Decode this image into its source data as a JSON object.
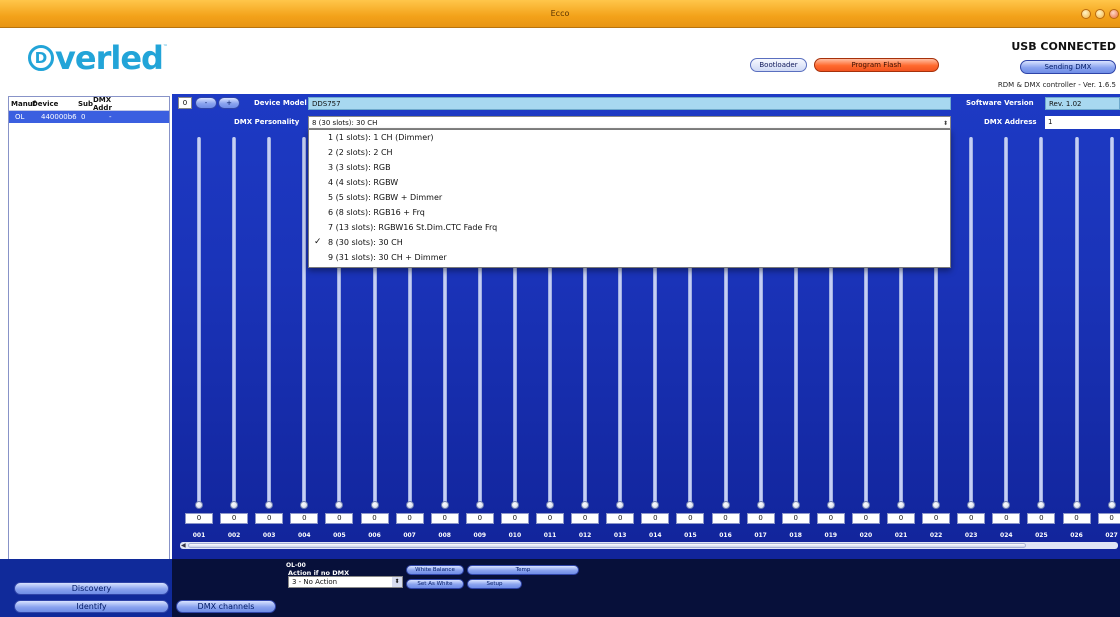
{
  "window": {
    "title": "Ecco"
  },
  "header": {
    "logo_text": "Overled",
    "bootloader_label": "Bootloader",
    "program_flash_label": "Program Flash",
    "usb_status": "USB CONNECTED",
    "sending_dmx_label": "Sending DMX",
    "version_text": "RDM & DMX controller - Ver. 1.6.5"
  },
  "device_list": {
    "headers": [
      "Manuf",
      "Device",
      "Sub",
      "DMX Addr"
    ],
    "rows": [
      {
        "manuf": "OL",
        "device": "440000b6",
        "sub": "0",
        "dmx_addr": "-"
      }
    ],
    "discovery_label": "Discovery",
    "identify_label": "Identify"
  },
  "controls": {
    "sub_index": "0",
    "minus_label": "-",
    "plus_label": "+",
    "device_model_label": "Device Model",
    "device_model_value": "DDS757",
    "software_version_label": "Software Version",
    "software_version_value": "Rev. 1.02",
    "dmx_personality_label": "DMX Personality",
    "dmx_personality_value": "8 (30 slots): 30 CH",
    "dmx_address_label": "DMX Address",
    "dmx_address_value": "1"
  },
  "personality_options": [
    {
      "label": "1 (1 slots): 1 CH (Dimmer)",
      "checked": false
    },
    {
      "label": "2 (2 slots): 2 CH",
      "checked": false
    },
    {
      "label": "3 (3 slots): RGB",
      "checked": false
    },
    {
      "label": "4 (4 slots): RGBW",
      "checked": false
    },
    {
      "label": "5 (5 slots): RGBW + Dimmer",
      "checked": false
    },
    {
      "label": "6 (8 slots): RGB16 + Frq",
      "checked": false
    },
    {
      "label": "7 (13 slots): RGBW16 St.Dim.CTC Fade Frq",
      "checked": false
    },
    {
      "label": "8 (30 slots): 30 CH",
      "checked": true
    },
    {
      "label": "9 (31 slots): 30 CH + Dimmer",
      "checked": false
    }
  ],
  "channels": [
    {
      "label": "001",
      "value": "0"
    },
    {
      "label": "002",
      "value": "0"
    },
    {
      "label": "003",
      "value": "0"
    },
    {
      "label": "004",
      "value": "0"
    },
    {
      "label": "005",
      "value": "0"
    },
    {
      "label": "006",
      "value": "0"
    },
    {
      "label": "007",
      "value": "0"
    },
    {
      "label": "008",
      "value": "0"
    },
    {
      "label": "009",
      "value": "0"
    },
    {
      "label": "010",
      "value": "0"
    },
    {
      "label": "011",
      "value": "0"
    },
    {
      "label": "012",
      "value": "0"
    },
    {
      "label": "013",
      "value": "0"
    },
    {
      "label": "014",
      "value": "0"
    },
    {
      "label": "015",
      "value": "0"
    },
    {
      "label": "016",
      "value": "0"
    },
    {
      "label": "017",
      "value": "0"
    },
    {
      "label": "018",
      "value": "0"
    },
    {
      "label": "019",
      "value": "0"
    },
    {
      "label": "020",
      "value": "0"
    },
    {
      "label": "021",
      "value": "0"
    },
    {
      "label": "022",
      "value": "0"
    },
    {
      "label": "023",
      "value": "0"
    },
    {
      "label": "024",
      "value": "0"
    },
    {
      "label": "025",
      "value": "0"
    },
    {
      "label": "026",
      "value": "0"
    },
    {
      "label": "027",
      "value": "0"
    }
  ],
  "bottom": {
    "dmx_channels_label": "DMX channels",
    "device_tag": "OL-00",
    "action_label": "Action if no DMX",
    "action_value": "3 - No Action",
    "white_balance_label": "White Balance",
    "temp_label": "Temp",
    "set_as_white_label": "Set As White",
    "setup_label": "Setup"
  },
  "colors": {
    "title_bar": "#f3a21a",
    "main_blue": "#1a33b8",
    "selected_row": "#3b5fe0",
    "logo": "#22a4d8",
    "program_flash": "#ff6a2e"
  }
}
